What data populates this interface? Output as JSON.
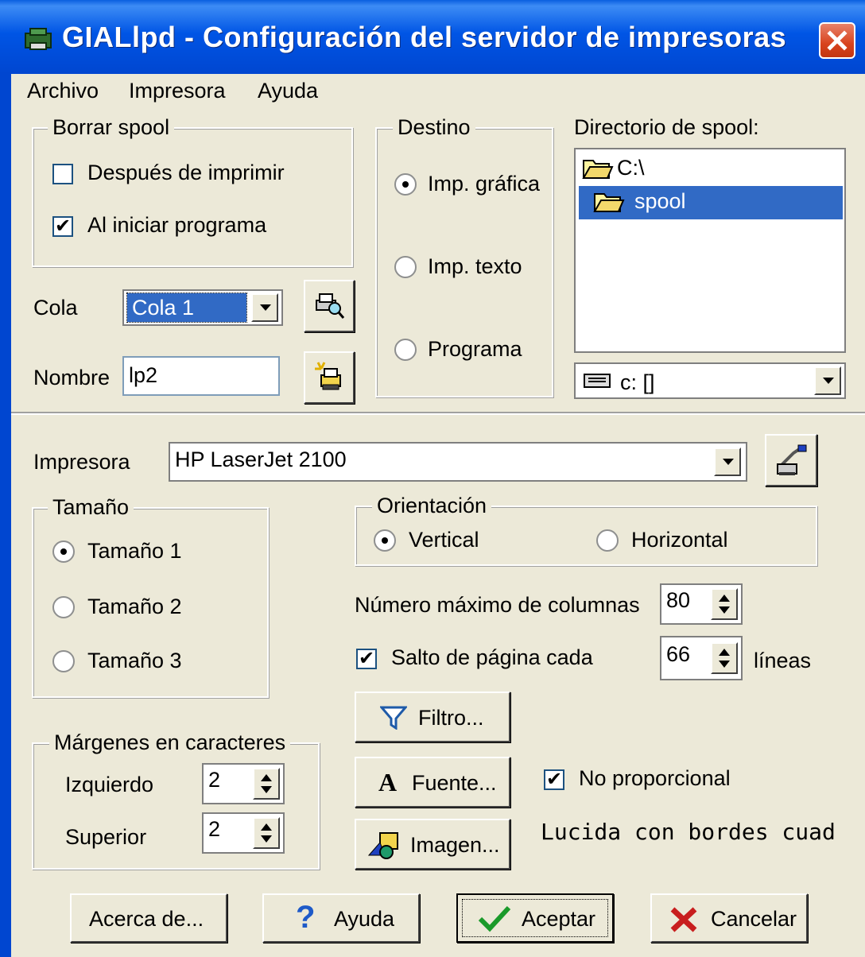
{
  "window": {
    "title": "GIALlpd - Configuración  del servidor de impresoras"
  },
  "menu": {
    "items": [
      "Archivo",
      "Impresora",
      "Ayuda"
    ]
  },
  "borrar_spool": {
    "group_label": "Borrar spool",
    "despues": {
      "label": "Después de imprimir",
      "checked": false
    },
    "al_iniciar": {
      "label": "Al iniciar programa",
      "checked": true
    }
  },
  "destino": {
    "group_label": "Destino",
    "options": [
      "Imp. gráfica",
      "Imp. texto",
      "Programa"
    ],
    "selected": "Imp. gráfica"
  },
  "spool_dir": {
    "label": "Directorio de spool:",
    "tree": [
      {
        "name": "C:\\",
        "selected": false
      },
      {
        "name": "spool",
        "selected": true
      }
    ],
    "drive": "c: []"
  },
  "cola": {
    "label": "Cola",
    "value": "Cola 1"
  },
  "nombre": {
    "label": "Nombre",
    "value": "lp2"
  },
  "impresora": {
    "label": "Impresora",
    "value": "HP LaserJet 2100"
  },
  "tamano": {
    "group_label": "Tamaño",
    "options": [
      "Tamaño 1",
      "Tamaño 2",
      "Tamaño 3"
    ],
    "selected": "Tamaño 1"
  },
  "orientacion": {
    "group_label": "Orientación",
    "vertical": "Vertical",
    "horizontal": "Horizontal",
    "selected": "Vertical"
  },
  "columnas": {
    "label": "Número máximo de columnas",
    "value": "80"
  },
  "salto": {
    "label": "Salto de página cada",
    "checked": true,
    "value": "66",
    "suffix": "líneas"
  },
  "margenes": {
    "group_label": "Márgenes en caracteres",
    "izquierdo_label": "Izquierdo",
    "izquierdo": "2",
    "superior_label": "Superior",
    "superior": "2"
  },
  "buttons": {
    "filtro": "Filtro...",
    "fuente": "Fuente...",
    "imagen": "Imagen...",
    "acerca": "Acerca de...",
    "ayuda": "Ayuda",
    "aceptar": "Aceptar",
    "cancelar": "Cancelar"
  },
  "no_proporcional": {
    "label": "No proporcional",
    "checked": true
  },
  "font_name": "Lucida con bordes cuad",
  "colors": {
    "titlebar": "#0055E5",
    "face": "#ECE9D8",
    "selection": "#316AC5"
  }
}
